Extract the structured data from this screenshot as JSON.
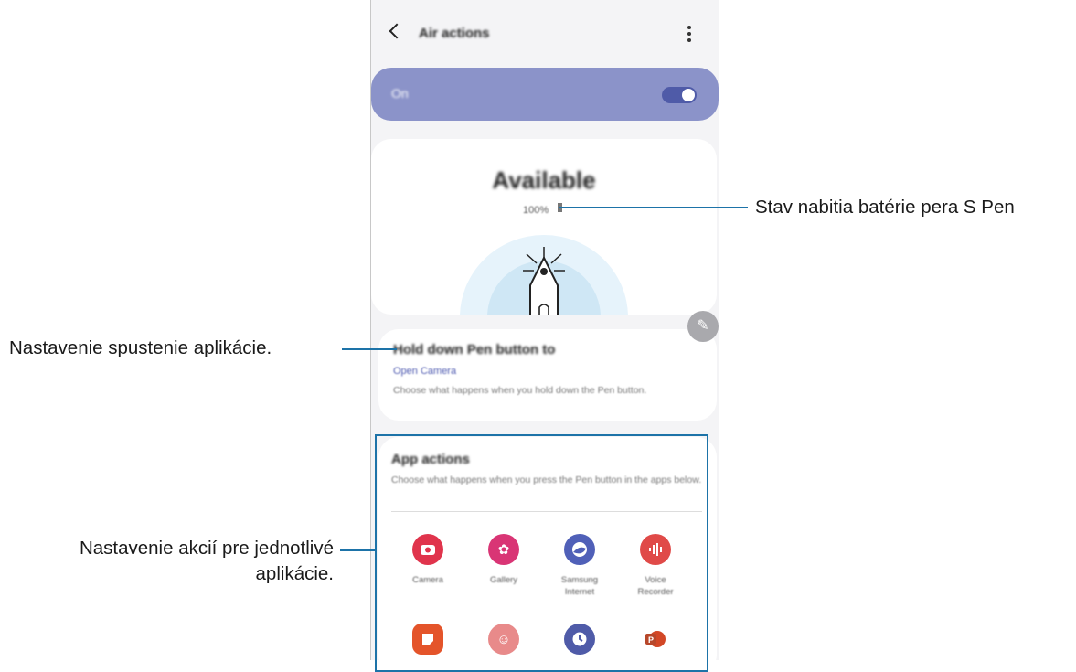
{
  "header": {
    "title": "Air actions"
  },
  "master_switch": {
    "label": "On",
    "state": "on"
  },
  "status": {
    "title": "Available",
    "battery": "100%"
  },
  "hold_button": {
    "title": "Hold down Pen button to",
    "value": "Open Camera",
    "description": "Choose what happens when you hold down the Pen button."
  },
  "app_actions": {
    "title": "App actions",
    "description": "Choose what happens when you press the Pen button in the apps below.",
    "apps": [
      {
        "name": "Camera",
        "icon": "camera-icon",
        "color": "#e0344c"
      },
      {
        "name": "Gallery",
        "icon": "gallery-icon",
        "color": "#d93575"
      },
      {
        "name": "Samsung Internet",
        "icon": "internet-icon",
        "color": "#5060b8"
      },
      {
        "name": "Voice Recorder",
        "icon": "voice-recorder-icon",
        "color": "#e04a48"
      },
      {
        "name": "",
        "icon": "notes-icon",
        "color": "#e4542a"
      },
      {
        "name": "",
        "icon": "ar-emoji-icon",
        "color": "#e88a8a"
      },
      {
        "name": "",
        "icon": "clock-icon",
        "color": "#4f5ba8"
      },
      {
        "name": "",
        "icon": "powerpoint-icon",
        "color": "#d24726"
      }
    ]
  },
  "callouts": {
    "battery": "Stav nabitia batérie pera S Pen",
    "app_launch": "Nastavenie spustenie aplikácie.",
    "app_actions_line1": "Nastavenie akcií pre jednotlivé",
    "app_actions_line2": "aplikácie."
  },
  "colors": {
    "accent": "#8b93c9",
    "callout": "#1d73a8"
  }
}
